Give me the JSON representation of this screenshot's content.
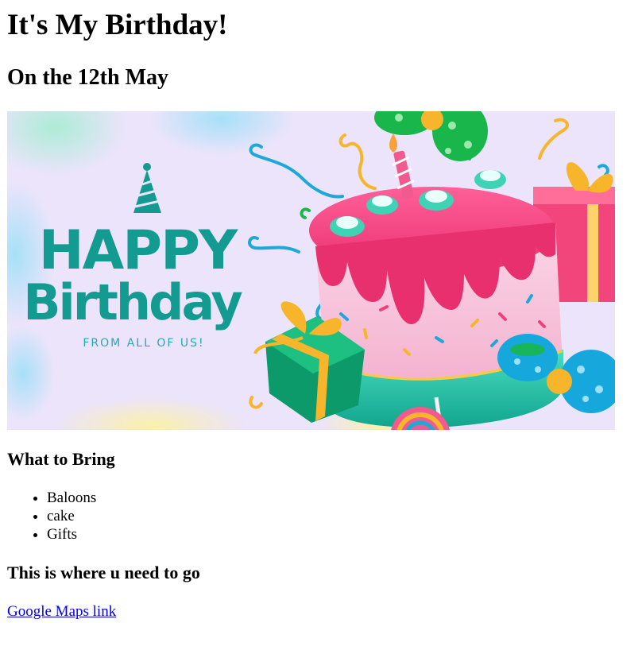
{
  "page": {
    "title": "It's My Birthday!",
    "date_heading": "On the 12th May"
  },
  "banner": {
    "happy": "HAPPY",
    "birthday": "Birthday",
    "subtitle": "FROM ALL OF US!",
    "colors": {
      "background": "#ebe4fb",
      "teal": "#139b92",
      "cake_pink": "#f0407a",
      "cake_teal": "#3fd3b6",
      "gift_yellow": "#f7b52c",
      "gift_green": "#0d9a6a",
      "bow_blue": "#16a8dc",
      "bow_green": "#19b64c"
    }
  },
  "bring": {
    "heading": "What to Bring",
    "items": [
      "Baloons",
      "cake",
      "Gifts"
    ]
  },
  "directions": {
    "heading": "This is where u need to go",
    "link_text": "Google Maps link",
    "link_color": "#0000ee"
  }
}
